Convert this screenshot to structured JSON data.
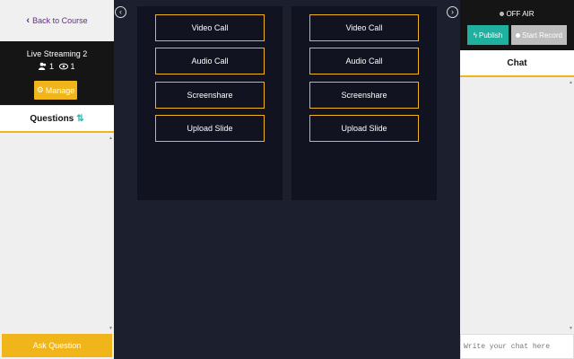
{
  "sidebar": {
    "back_label": "Back to Course",
    "stream_title": "Live Streaming 2",
    "participants_count": "1",
    "viewers_count": "1",
    "manage_label": "Manage",
    "questions_label": "Questions",
    "ask_label": "Ask Question"
  },
  "panels": [
    {
      "buttons": [
        "Video Call",
        "Audio Call",
        "Screenshare",
        "Upload Slide"
      ]
    },
    {
      "buttons": [
        "Video Call",
        "Audio Call",
        "Screenshare",
        "Upload Slide"
      ]
    }
  ],
  "broadcast": {
    "status": "OFF AIR",
    "publish_label": "Publish",
    "record_label": "Start Record"
  },
  "chat": {
    "title": "Chat",
    "placeholder": "Write your chat here"
  },
  "colors": {
    "accent": "#f0b51a",
    "publish": "#1fb0a0",
    "stage_bg": "#1c1f2d",
    "panel_bg": "#111320"
  }
}
